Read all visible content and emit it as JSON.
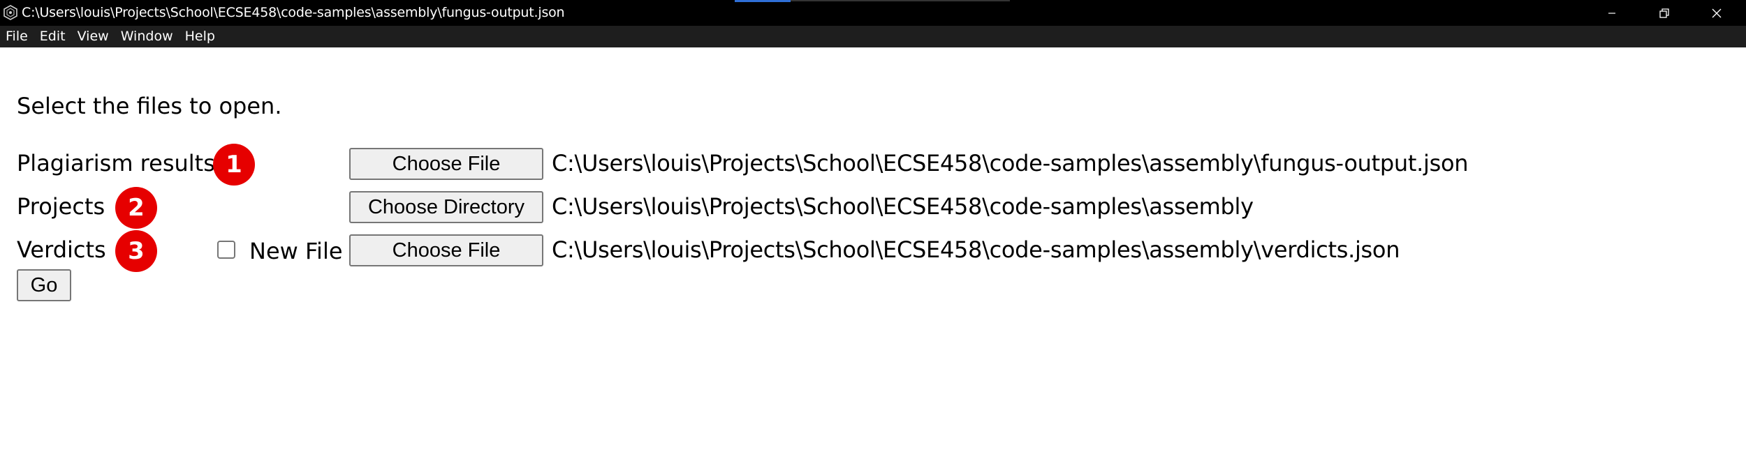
{
  "window": {
    "title": "C:\\Users\\louis\\Projects\\School\\ECSE458\\code-samples\\assembly\\fungus-output.json",
    "icon": "app-hexagon-icon"
  },
  "window_controls": {
    "minimize": "–",
    "maximize": "❐",
    "close": "✕"
  },
  "menu": [
    "File",
    "Edit",
    "View",
    "Window",
    "Help"
  ],
  "page": {
    "instructions": "Select the files to open.",
    "rows": [
      {
        "label": "Plagiarism results",
        "badge": "1",
        "button": "Choose File",
        "path": "C:\\Users\\louis\\Projects\\School\\ECSE458\\code-samples\\assembly\\fungus-output.json"
      },
      {
        "label": "Projects",
        "badge": "2",
        "button": "Choose Directory",
        "path": "C:\\Users\\louis\\Projects\\School\\ECSE458\\code-samples\\assembly"
      },
      {
        "label": "Verdicts",
        "badge": "3",
        "button": "Choose File",
        "path": "C:\\Users\\louis\\Projects\\School\\ECSE458\\code-samples\\assembly\\verdicts.json",
        "checkbox_label": "New File",
        "checkbox_checked": false
      }
    ],
    "go_button": "Go"
  },
  "colors": {
    "titlebar": "#000000",
    "menubar": "#1e1e1e",
    "badge": "#e60000",
    "button_bg": "#efefef",
    "button_border": "#767676"
  }
}
